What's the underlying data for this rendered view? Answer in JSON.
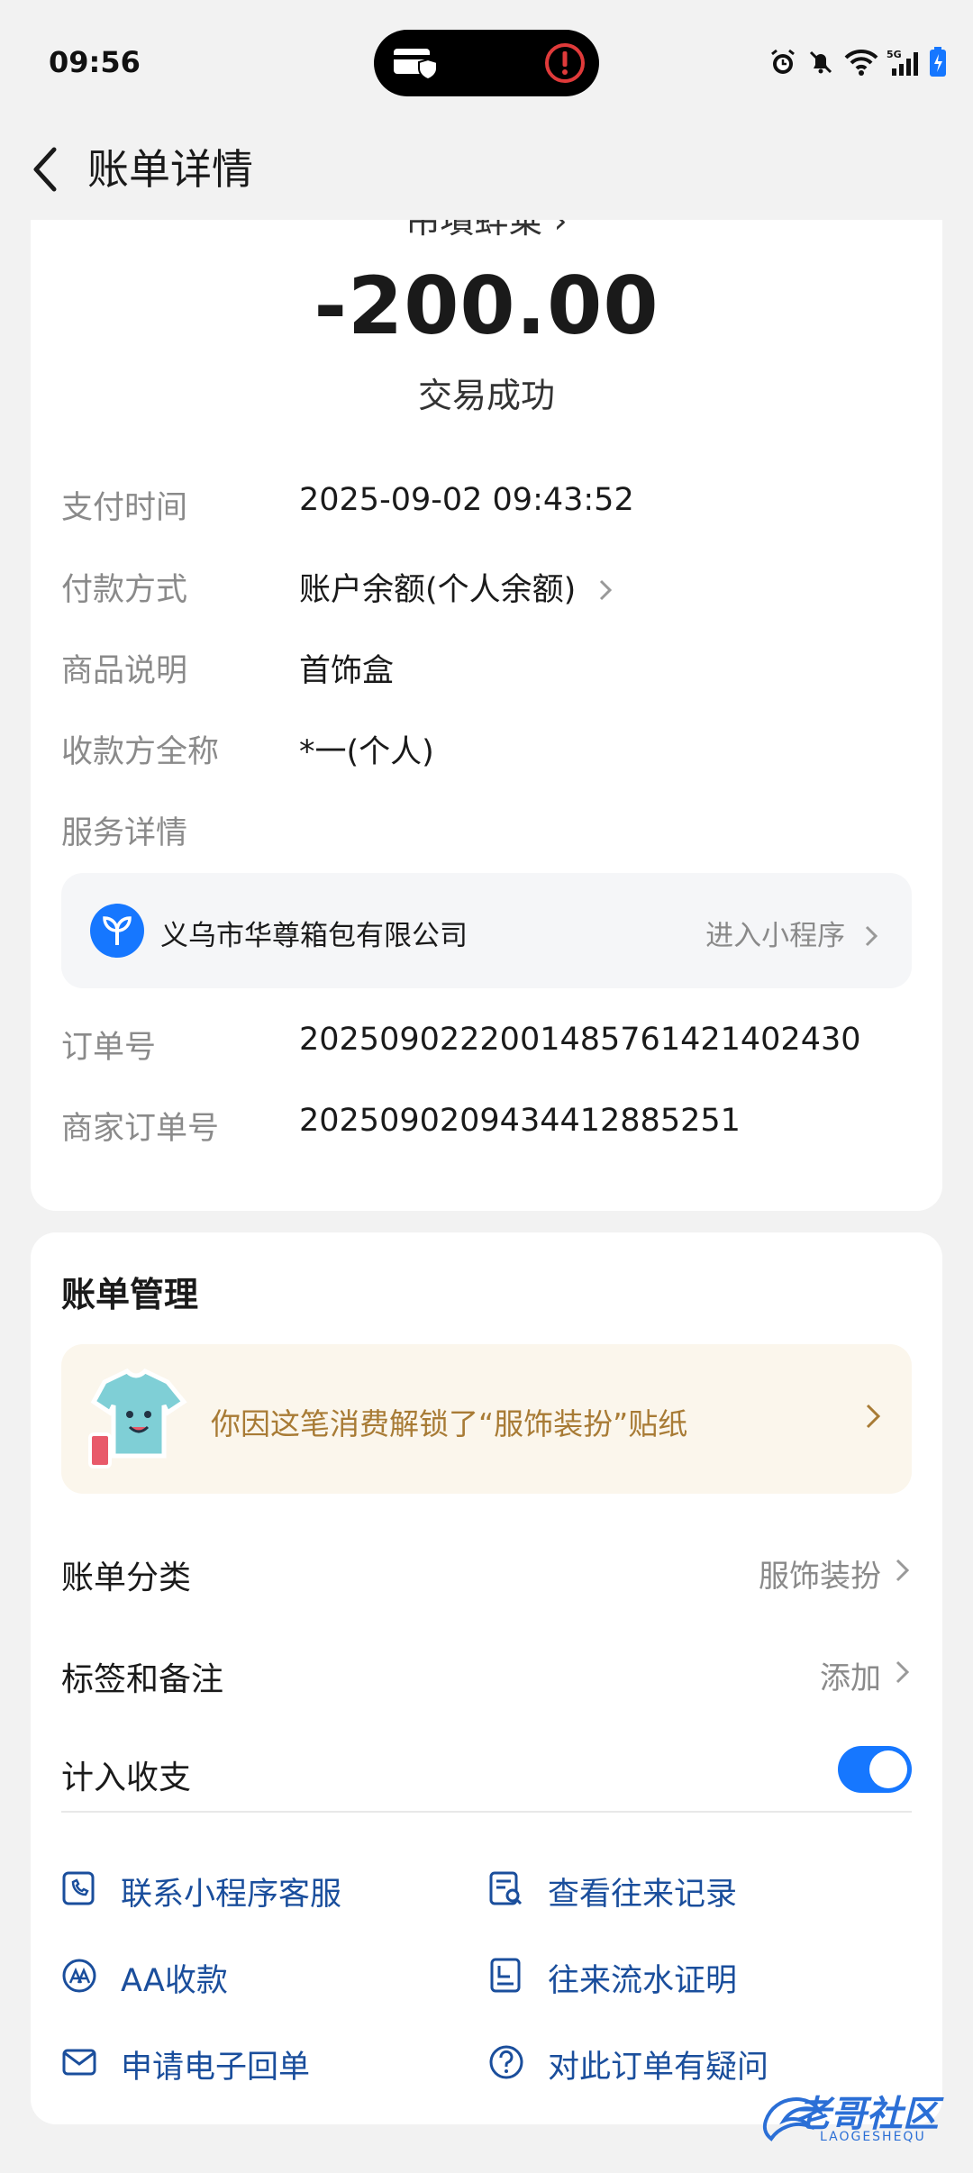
{
  "status_bar": {
    "time": "09:56"
  },
  "header": {
    "title": "账单详情"
  },
  "summary": {
    "merchant_partial": "吊墳蚌乗 ›",
    "amount": "-200.00",
    "status": "交易成功"
  },
  "details": [
    {
      "label": "支付时间",
      "value": "2025-09-02 09:43:52"
    },
    {
      "label": "付款方式",
      "value": "账户余额(个人余额)"
    },
    {
      "label": "商品说明",
      "value": "首饰盒"
    },
    {
      "label": "收款方全称",
      "value": "*一(个人)"
    },
    {
      "label": "服务详情",
      "value": ""
    }
  ],
  "service": {
    "name": "义乌市华尊箱包有限公司",
    "link": "进入小程序"
  },
  "orders": [
    {
      "label": "订单号",
      "value": "2025090222001485761421402430"
    },
    {
      "label": "商家订单号",
      "value": "20250902094344128852​51"
    }
  ],
  "management": {
    "title": "账单管理",
    "sticker_text": "你因这笔消费解锁了“服饰装扮”贴纸",
    "category_label": "账单分类",
    "category_value": "服饰装扮",
    "tags_label": "标签和备注",
    "tags_value": "添加",
    "count_label": "计入收支",
    "count_on": true
  },
  "actions": [
    {
      "label": "联系小程序客服",
      "icon": "phone-chat-icon"
    },
    {
      "label": "查看往来记录",
      "icon": "record-search-icon"
    },
    {
      "label": "AA收款",
      "icon": "aa-icon"
    },
    {
      "label": "往来流水证明",
      "icon": "statement-icon"
    },
    {
      "label": "申请电子回单",
      "icon": "mail-icon"
    },
    {
      "label": "对此订单有疑问",
      "icon": "question-icon"
    }
  ],
  "watermark": {
    "text": "老哥社区",
    "sub": "LAOGESHEQU"
  },
  "colors": {
    "accent": "#1677ff",
    "link": "#1a4e9c",
    "sticker_text": "#a87b35"
  }
}
